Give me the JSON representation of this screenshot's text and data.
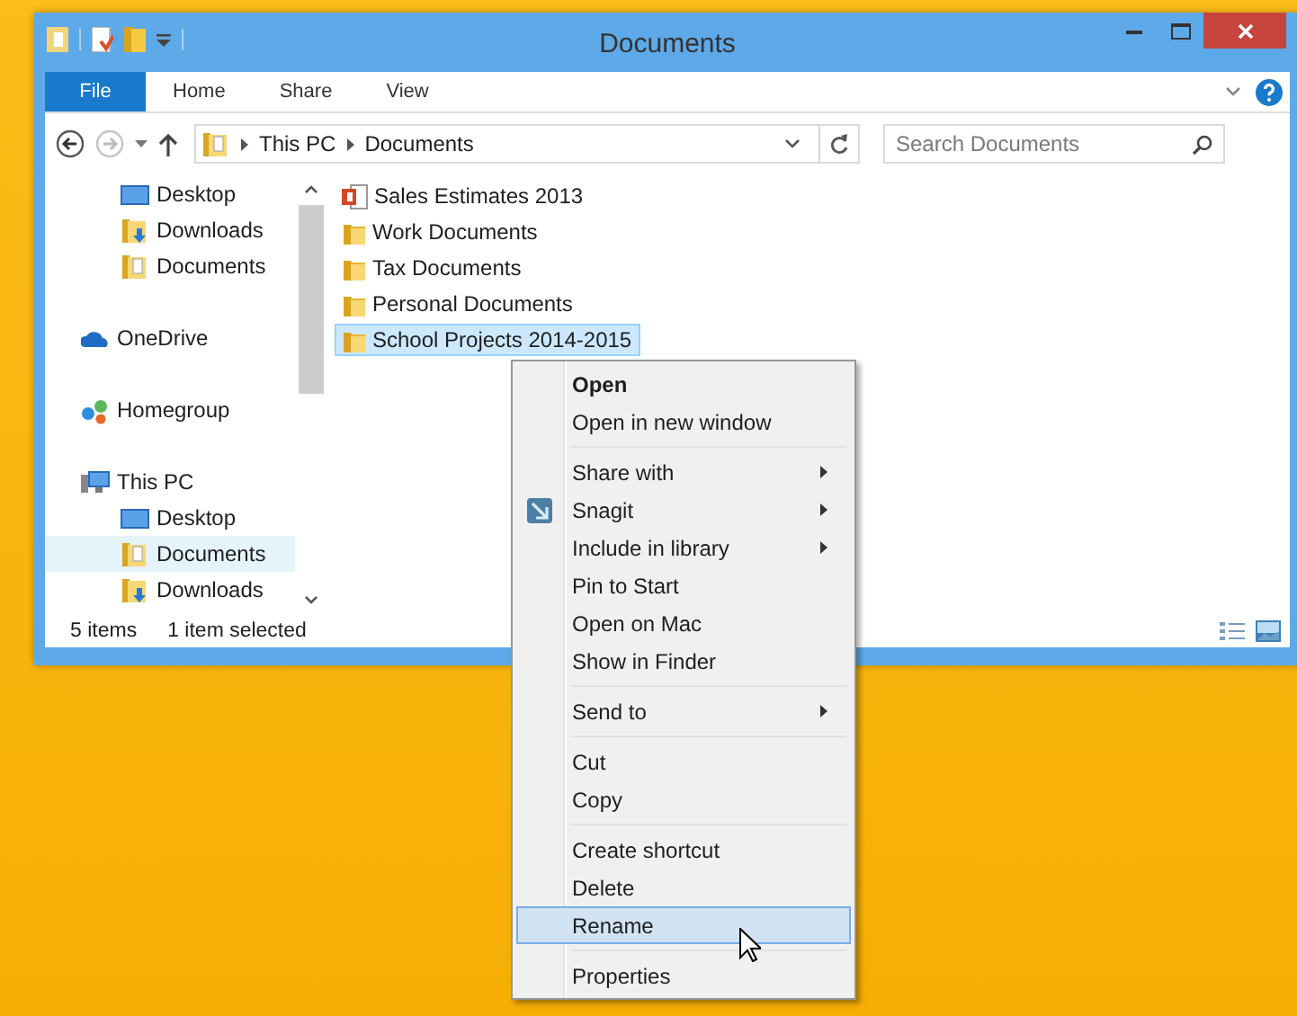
{
  "window": {
    "title": "Documents"
  },
  "ribbon": {
    "file_tab": "File",
    "tabs": [
      "Home",
      "Share",
      "View"
    ]
  },
  "address": {
    "path": [
      "This PC",
      "Documents"
    ]
  },
  "search": {
    "placeholder": "Search Documents"
  },
  "nav": [
    {
      "children": [
        {
          "label": "Desktop",
          "kind": "desktop",
          "selected": false
        },
        {
          "label": "Downloads",
          "kind": "downloads",
          "selected": false
        },
        {
          "label": "Documents",
          "kind": "documents",
          "selected": false
        }
      ]
    },
    {
      "label": "OneDrive",
      "kind": "onedrive",
      "selected": false
    },
    {
      "label": "Homegroup",
      "kind": "homegroup",
      "selected": false
    },
    {
      "label": "This PC",
      "kind": "pc",
      "selected": false,
      "children": [
        {
          "label": "Desktop",
          "kind": "desktop",
          "selected": false
        },
        {
          "label": "Documents",
          "kind": "documents",
          "selected": true
        },
        {
          "label": "Downloads",
          "kind": "downloads",
          "selected": false
        }
      ]
    }
  ],
  "files": [
    {
      "name": "Sales Estimates 2013",
      "kind": "presentation",
      "selected": false
    },
    {
      "name": "Work Documents",
      "kind": "folder",
      "selected": false
    },
    {
      "name": "Tax Documents",
      "kind": "folder",
      "selected": false
    },
    {
      "name": "Personal Documents",
      "kind": "folder",
      "selected": false
    },
    {
      "name": "School Projects 2014-2015",
      "kind": "folder",
      "selected": true
    }
  ],
  "status_bar": {
    "count": "5 items",
    "selection": "1 item selected"
  },
  "context_menu": [
    {
      "kind": "item",
      "label": "Open",
      "bold": true,
      "submenu": false,
      "icon": false,
      "selected": false
    },
    {
      "kind": "item",
      "label": "Open in new window",
      "bold": false,
      "submenu": false,
      "icon": false,
      "selected": false
    },
    {
      "kind": "separator"
    },
    {
      "kind": "item",
      "label": "Share with",
      "bold": false,
      "submenu": true,
      "icon": false,
      "selected": false
    },
    {
      "kind": "item",
      "label": "Snagit",
      "bold": false,
      "submenu": true,
      "icon": true,
      "selected": false
    },
    {
      "kind": "item",
      "label": "Include in library",
      "bold": false,
      "submenu": true,
      "icon": false,
      "selected": false
    },
    {
      "kind": "item",
      "label": "Pin to Start",
      "bold": false,
      "submenu": false,
      "icon": false,
      "selected": false
    },
    {
      "kind": "item",
      "label": "Open on Mac",
      "bold": false,
      "submenu": false,
      "icon": false,
      "selected": false
    },
    {
      "kind": "item",
      "label": "Show in Finder",
      "bold": false,
      "submenu": false,
      "icon": false,
      "selected": false
    },
    {
      "kind": "separator"
    },
    {
      "kind": "item",
      "label": "Send to",
      "bold": false,
      "submenu": true,
      "icon": false,
      "selected": false
    },
    {
      "kind": "separator"
    },
    {
      "kind": "item",
      "label": "Cut",
      "bold": false,
      "submenu": false,
      "icon": false,
      "selected": false
    },
    {
      "kind": "item",
      "label": "Copy",
      "bold": false,
      "submenu": false,
      "icon": false,
      "selected": false
    },
    {
      "kind": "separator"
    },
    {
      "kind": "item",
      "label": "Create shortcut",
      "bold": false,
      "submenu": false,
      "icon": false,
      "selected": false
    },
    {
      "kind": "item",
      "label": "Delete",
      "bold": false,
      "submenu": false,
      "icon": false,
      "selected": false
    },
    {
      "kind": "item",
      "label": "Rename",
      "bold": false,
      "submenu": false,
      "icon": false,
      "selected": true
    },
    {
      "kind": "separator"
    },
    {
      "kind": "item",
      "label": "Properties",
      "bold": false,
      "submenu": false,
      "icon": false,
      "selected": false
    }
  ]
}
